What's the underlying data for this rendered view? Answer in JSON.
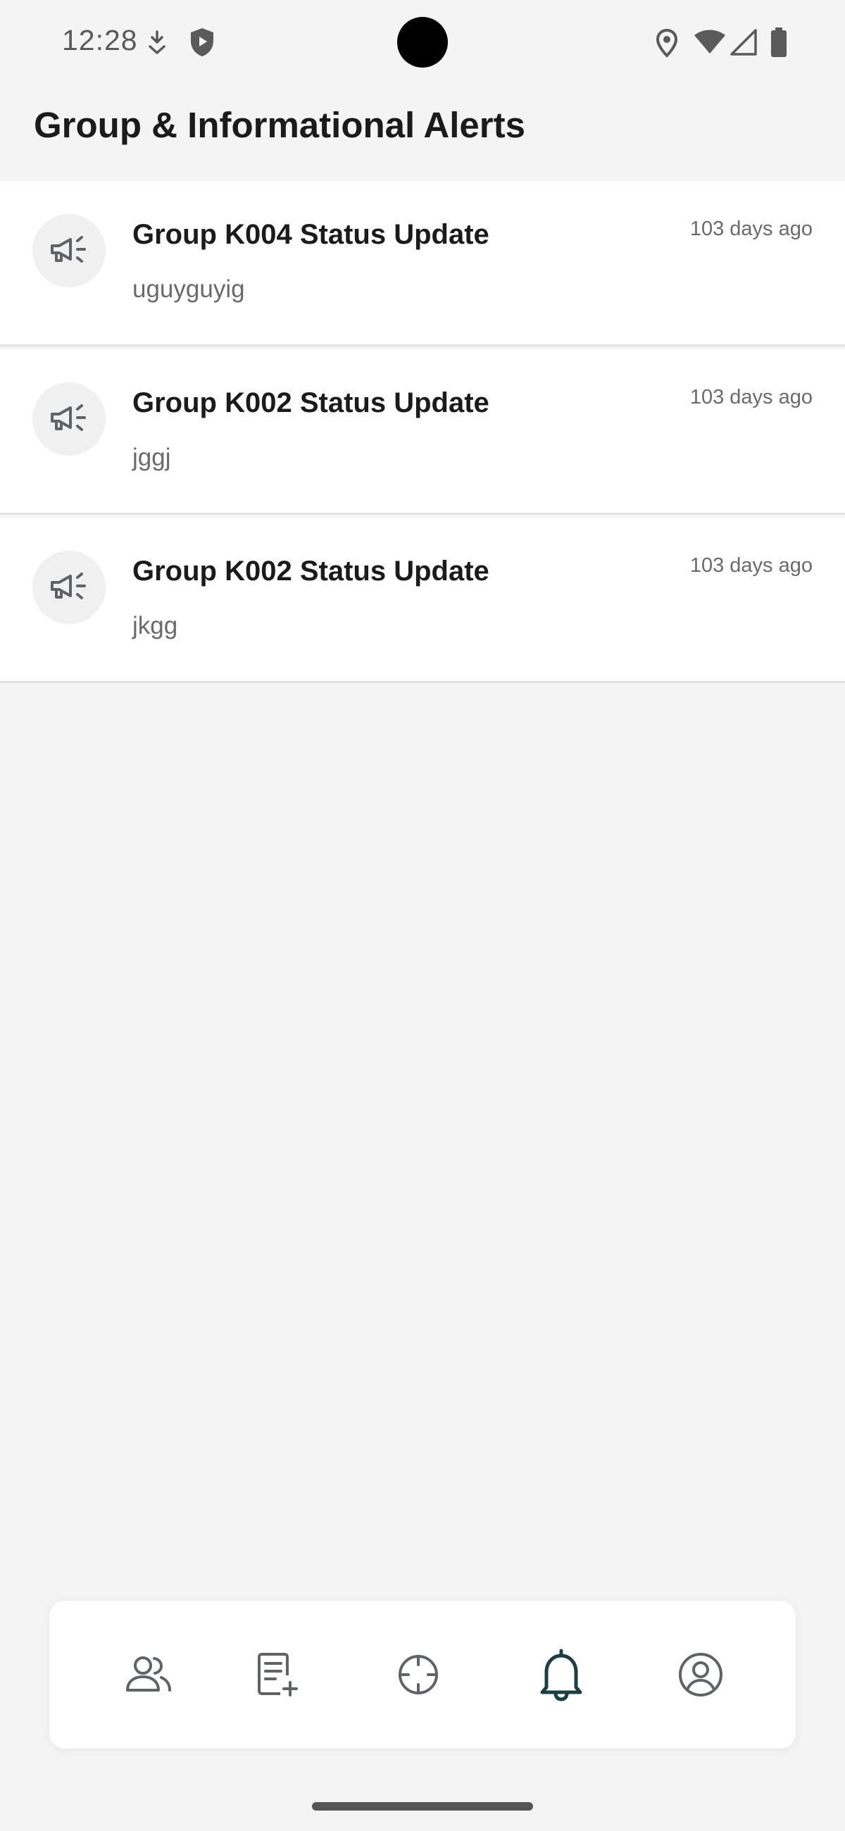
{
  "status_bar": {
    "time": "12:28"
  },
  "header": {
    "title": "Group & Informational Alerts"
  },
  "alerts": [
    {
      "title": "Group K004 Status Update",
      "message": "uguyguyig",
      "time": "103 days ago",
      "icon": "megaphone-icon"
    },
    {
      "title": "Group K002 Status Update",
      "message": "jggj",
      "time": "103 days ago",
      "icon": "megaphone-icon"
    },
    {
      "title": "Group K002 Status Update",
      "message": "jkgg",
      "time": "103 days ago",
      "icon": "megaphone-icon"
    }
  ],
  "bottom_nav": {
    "items": [
      {
        "icon": "users-icon",
        "active": false
      },
      {
        "icon": "add-note-icon",
        "active": false
      },
      {
        "icon": "crosshair-icon",
        "active": false
      },
      {
        "icon": "bell-icon",
        "active": true
      },
      {
        "icon": "profile-icon",
        "active": false
      }
    ]
  },
  "colors": {
    "background": "#f4f4f4",
    "card": "#ffffff",
    "text_primary": "#1b1b1b",
    "text_secondary": "#6a6a6a",
    "nav_icon": "#5f6368",
    "nav_icon_active": "#1f3d45"
  }
}
